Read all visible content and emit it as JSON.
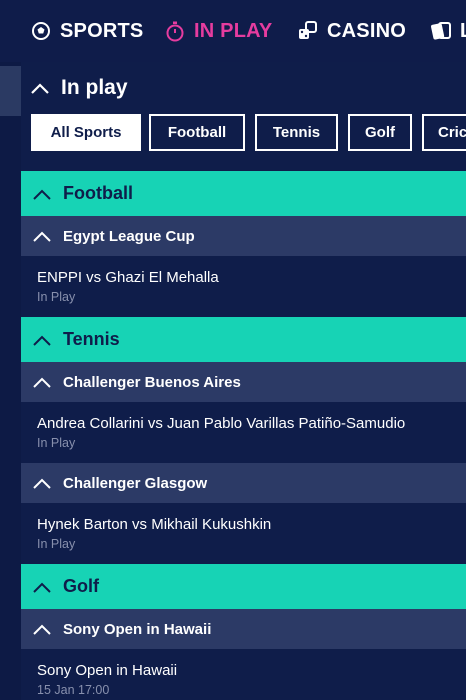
{
  "topnav": {
    "items": [
      {
        "label": "SPORTS",
        "icon": "soccer-ball-icon"
      },
      {
        "label": "IN PLAY",
        "icon": "stopwatch-icon",
        "color": "#e63c9f"
      },
      {
        "label": "CASINO",
        "icon": "dice-icon"
      },
      {
        "label": "L",
        "icon": "cards-icon"
      }
    ]
  },
  "inplay": {
    "title": "In play"
  },
  "filters": [
    "All Sports",
    "Football",
    "Tennis",
    "Golf",
    "Cric"
  ],
  "sections": [
    {
      "sport": "Football",
      "competitions": [
        {
          "name": "Egypt League Cup",
          "events": [
            {
              "name": "ENPPI vs Ghazi El Mehalla",
              "status": "In Play"
            }
          ]
        }
      ]
    },
    {
      "sport": "Tennis",
      "competitions": [
        {
          "name": "Challenger Buenos Aires",
          "events": [
            {
              "name": "Andrea Collarini vs Juan Pablo Varillas Patiño-Samudio",
              "status": "In Play"
            }
          ]
        },
        {
          "name": "Challenger Glasgow",
          "events": [
            {
              "name": "Hynek Barton vs Mikhail Kukushkin",
              "status": "In Play"
            }
          ]
        }
      ]
    },
    {
      "sport": "Golf",
      "competitions": [
        {
          "name": "Sony Open in Hawaii",
          "events": [
            {
              "name": "Sony Open in Hawaii",
              "status": "15 Jan 17:00"
            }
          ]
        }
      ]
    }
  ],
  "colors": {
    "accent": "#17d3b5",
    "inplay": "#e63c9f",
    "background": "#0f1d4a",
    "competition": "#2c3a66"
  }
}
